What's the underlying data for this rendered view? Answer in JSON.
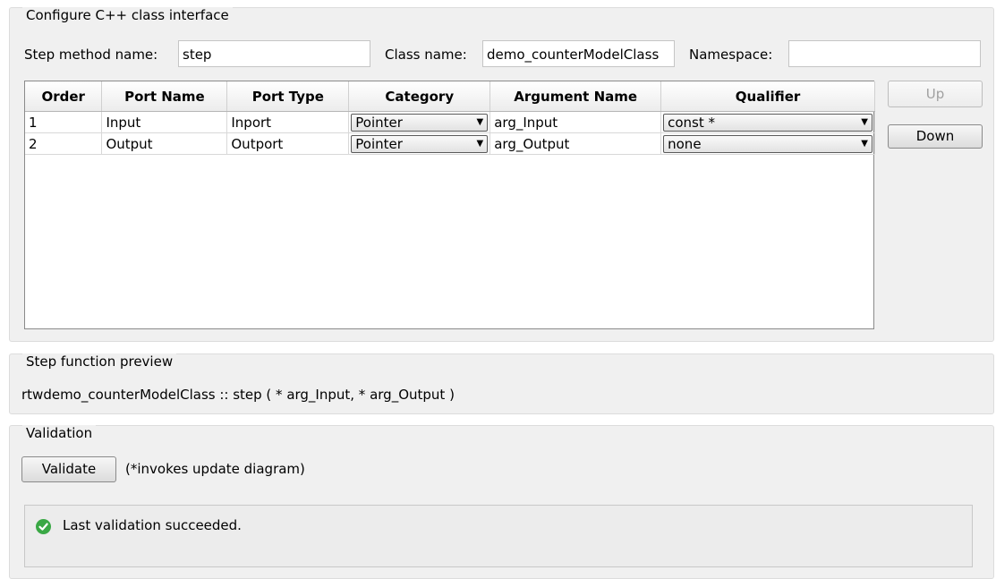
{
  "interface_group": {
    "title": "Configure C++ class interface",
    "step_method_label": "Step method name:",
    "step_method_value": "step",
    "class_name_label": "Class name:",
    "class_name_value": "demo_counterModelClass",
    "namespace_label": "Namespace:",
    "namespace_value": "",
    "up_label": "Up",
    "down_label": "Down"
  },
  "table": {
    "columns": [
      "Order",
      "Port Name",
      "Port Type",
      "Category",
      "Argument Name",
      "Qualifier"
    ],
    "rows": [
      {
        "order": "1",
        "port_name": "Input",
        "port_type": "Inport",
        "category": "Pointer",
        "argument_name": "arg_Input",
        "qualifier": "const *"
      },
      {
        "order": "2",
        "port_name": "Output",
        "port_type": "Outport",
        "category": "Pointer",
        "argument_name": "arg_Output",
        "qualifier": "none"
      }
    ]
  },
  "preview_group": {
    "title": "Step function preview",
    "text": "rtwdemo_counterModelClass :: step ( * arg_Input, * arg_Output )"
  },
  "validation_group": {
    "title": "Validation",
    "validate_label": "Validate",
    "note": "(*invokes update diagram)",
    "status_text": "Last validation succeeded.",
    "status_color": "#3aa845"
  }
}
